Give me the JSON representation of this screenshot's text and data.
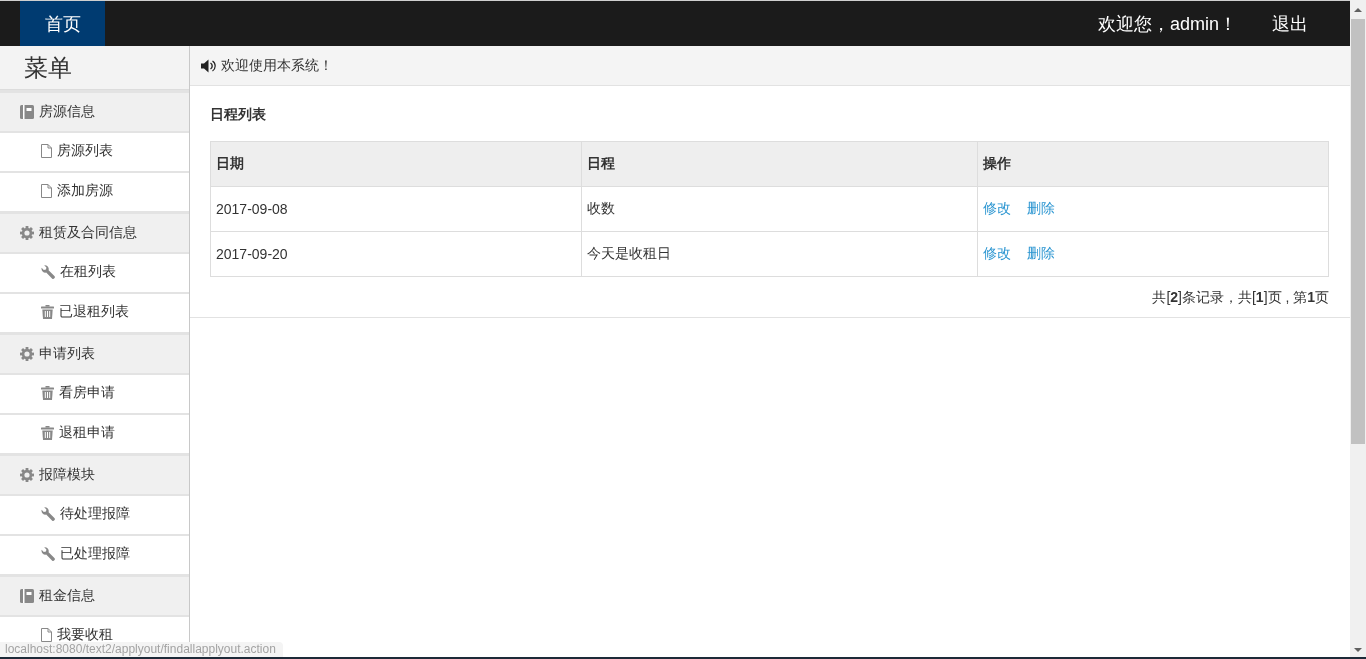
{
  "topbar": {
    "nav": [
      {
        "label": "首页",
        "selected": true
      }
    ],
    "greeting": "欢迎您，admin！",
    "logout": "退出"
  },
  "sidebar": {
    "title": "菜单",
    "groups": [
      {
        "label": "房源信息",
        "children": [
          {
            "label": "房源列表"
          },
          {
            "label": "添加房源"
          }
        ]
      },
      {
        "label": "租赁及合同信息",
        "children": [
          {
            "label": "在租列表"
          },
          {
            "label": "已退租列表"
          }
        ]
      },
      {
        "label": "申请列表",
        "children": [
          {
            "label": "看房申请"
          },
          {
            "label": "退租申请"
          }
        ]
      },
      {
        "label": "报障模块",
        "children": [
          {
            "label": "待处理报障"
          },
          {
            "label": "已处理报障"
          }
        ]
      },
      {
        "label": "租金信息",
        "children": [
          {
            "label": "我要收租"
          }
        ]
      }
    ]
  },
  "notice": {
    "text": "欢迎使用本系统！"
  },
  "schedule": {
    "title": "日程列表",
    "columns": [
      "日期",
      "日程",
      "操作"
    ],
    "rows": [
      {
        "date": "2017-09-08",
        "event": "收数",
        "actions": [
          "修改",
          "删除"
        ]
      },
      {
        "date": "2017-09-20",
        "event": "今天是收租日",
        "actions": [
          "修改",
          "删除"
        ]
      }
    ],
    "pagination": "共[**2**]条记录，共[**1**]页 , 第**1**页"
  },
  "status_bar": {
    "url": "localhost:8080/text2/applyout/findallapplyout.action"
  }
}
